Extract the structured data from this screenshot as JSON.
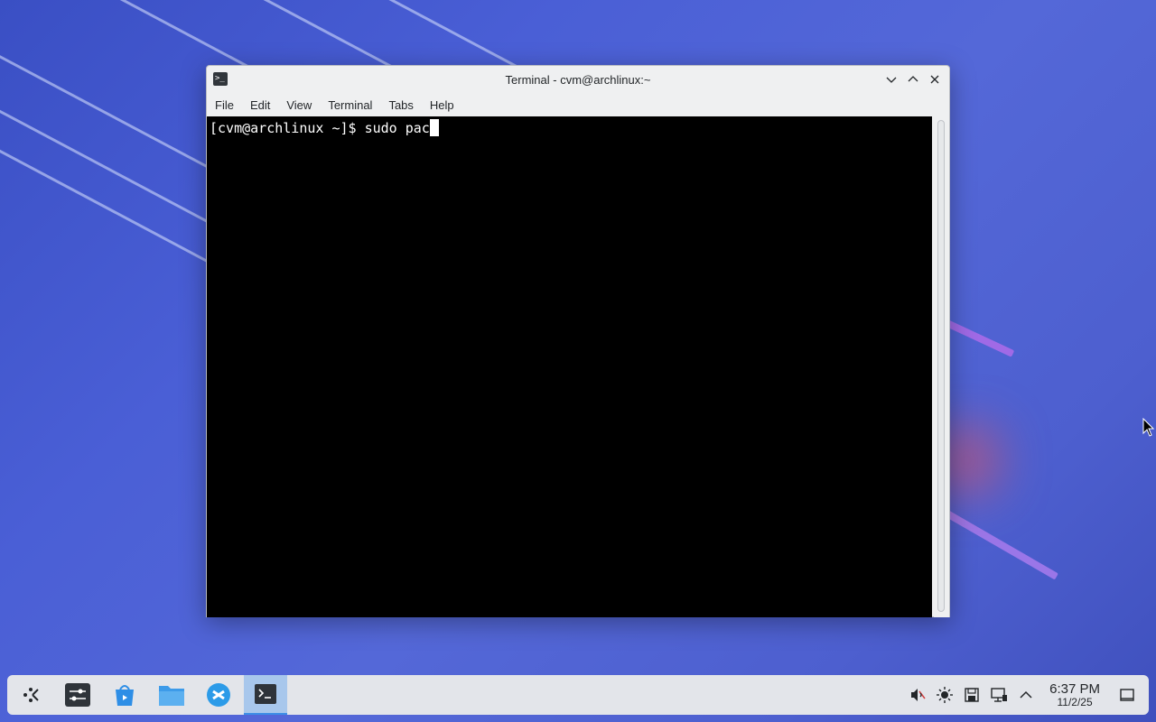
{
  "window": {
    "title": "Terminal - cvm@archlinux:~",
    "menu": [
      "File",
      "Edit",
      "View",
      "Terminal",
      "Tabs",
      "Help"
    ]
  },
  "terminal": {
    "prompt": "[cvm@archlinux ~]$ ",
    "input": "sudo pac"
  },
  "taskbar": {
    "apps": [
      {
        "name": "app-launcher-icon"
      },
      {
        "name": "system-settings-icon"
      },
      {
        "name": "discover-icon"
      },
      {
        "name": "file-manager-icon"
      },
      {
        "name": "browser-icon"
      },
      {
        "name": "terminal-icon",
        "active": true
      }
    ],
    "tray": [
      "volume-muted-icon",
      "brightness-icon",
      "save-icon",
      "network-icon",
      "show-hidden-icon"
    ],
    "clock": {
      "time": "6:37 PM",
      "date": "11/2/25"
    }
  },
  "colors": {
    "accent": "#3d8ee6",
    "terminal_bg": "#000000",
    "window_bg": "#eff0f1"
  }
}
